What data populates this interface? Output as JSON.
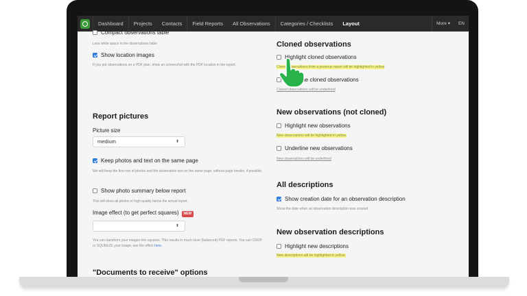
{
  "nav": {
    "items": [
      "Dashboard",
      "Projects",
      "Contacts",
      "Field Reports",
      "All Observations",
      "Categories / Checklists",
      "Layout"
    ],
    "active": "Layout",
    "more": "More ▾",
    "lang": "EN"
  },
  "left": {
    "compact": {
      "label": "Compact observations table",
      "help": "Less white space in the observations table"
    },
    "location": {
      "label": "Show location images",
      "help": "If you put observations on a PDF plan, show an screenshot with the PDF location in the report."
    },
    "report_pictures": {
      "title": "Report pictures",
      "picture_size_label": "Picture size",
      "picture_size_value": "medium",
      "keep": {
        "label": "Keep photos and text on the same page",
        "help": "We will keep the first row of photos and the observation text on the same page, without page breaks, if possible."
      },
      "summary": {
        "label": "Show photo summary below report",
        "help": "This will show all photos in high quality below the actual report."
      },
      "effect_label": "Image effect (to get perfect squares)",
      "effect_badge": "NEW",
      "effect_value": "",
      "effect_help": "You can transform your images into squares. This results in much nicer (balanced) PDF reports. You can CROP or SQUEEZE your image, see the effect",
      "effect_help_link": "here."
    },
    "documents_title": "\"Documents to receive\" options"
  },
  "right": {
    "cloned": {
      "title": "Cloned observations",
      "highlight_label": "Highlight cloned observations",
      "highlight_help": "Cloned observations from a previous report will be highlighted in yellow",
      "underline_label": "Underline cloned observations",
      "underline_help": "Cloned observations will be underlined"
    },
    "new_obs": {
      "title": "New observations (not cloned)",
      "highlight_label": "Highlight new observations",
      "highlight_help": "New observations will be highlighted in yellow.",
      "underline_label": "Underline new observations",
      "underline_help": "New observations will be underlined"
    },
    "all_desc": {
      "title": "All descriptions",
      "label": "Show creation date for an observation description",
      "help": "Show the date when an observation description was created"
    },
    "new_desc": {
      "title": "New observation descriptions",
      "label": "Highlight new descriptions",
      "help": "New descriptions will be highlighted in yellow."
    }
  },
  "colors": {
    "accent": "#2f7de1",
    "navbar": "#2a2a2a",
    "highlight": "#f6f38a",
    "cursor": "#27b24a"
  },
  "icons": {
    "cursor": "hand-pointer-icon"
  }
}
